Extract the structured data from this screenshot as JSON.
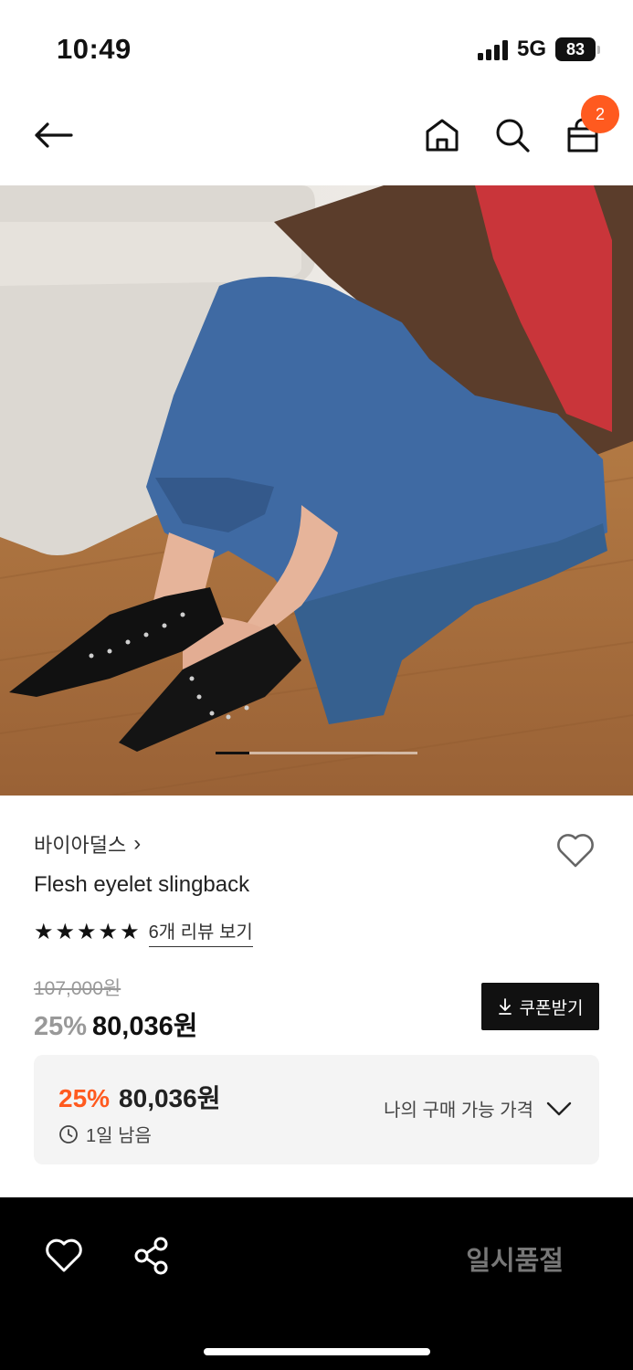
{
  "status_bar": {
    "time": "10:49",
    "network": "5G",
    "battery": "83"
  },
  "nav": {
    "cart_count": "2"
  },
  "product": {
    "brand": "바이아덜스",
    "brand_chevron": "›",
    "name": "Flesh eyelet slingback",
    "rating_stars": 5,
    "review_link": "6개 리뷰 보기",
    "original_price": "107,000원",
    "discount": "25%",
    "final_price": "80,036원",
    "coupon_button": "쿠폰받기",
    "image_index": 1,
    "image_count": 6
  },
  "price_box": {
    "discount": "25%",
    "final_price": "80,036원",
    "time_left": "1일 남음",
    "my_price_label": "나의 구매 가능 가격"
  },
  "bottom_bar": {
    "status": "일시품절"
  },
  "colors": {
    "accent": "#ff5a1f",
    "dark": "#111111",
    "price_box_bg": "#f4f4f4"
  }
}
